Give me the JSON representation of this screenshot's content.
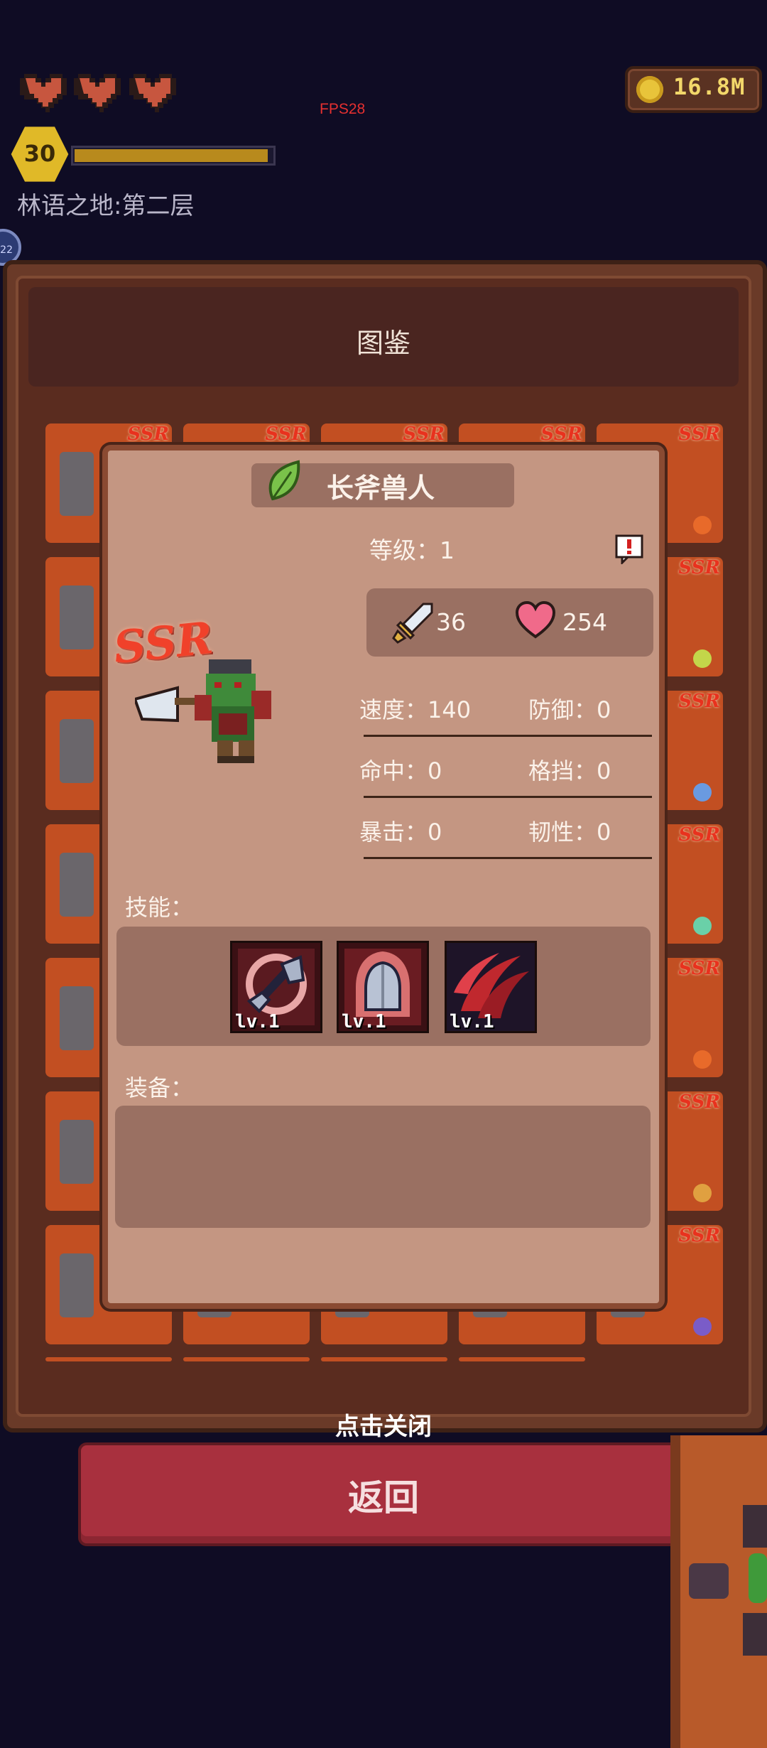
{
  "hud": {
    "hearts": 3,
    "gold": "16.8M",
    "fps": "FPS28",
    "level": "30",
    "xp_progress": 0.97,
    "area_name": "林语之地:第二层",
    "side_badge": "22"
  },
  "panel": {
    "title": "图鉴",
    "card_badge": "SSR",
    "card_gem_colors": [
      "#e86a2a",
      "#c3d64a",
      "#6a9ae0",
      "#6ad0a8",
      "#e86a2a",
      "#e0a040",
      "#7a5cc8"
    ]
  },
  "dialog": {
    "unit_name": "长斧兽人",
    "level_label": "等级：1",
    "rarity": "SSR",
    "attack": "36",
    "hp": "254",
    "stats": [
      {
        "left": "速度：140",
        "right": "防御：0"
      },
      {
        "left": "命中：0",
        "right": "格挡：0"
      },
      {
        "left": "暴击：0",
        "right": "韧性：0"
      }
    ],
    "skills_label": "技能：",
    "skills": [
      {
        "icon": "axe-skill-icon",
        "level": "lv.1",
        "color": "#e8a6a6"
      },
      {
        "icon": "shield-skill-icon",
        "level": "lv.1",
        "color": "#d87070"
      },
      {
        "icon": "claw-skill-icon",
        "level": "lv.1",
        "color": "#2a1a30"
      }
    ],
    "equipment_label": "装备："
  },
  "footer": {
    "close_hint": "点击关闭",
    "back_label": "返回"
  }
}
